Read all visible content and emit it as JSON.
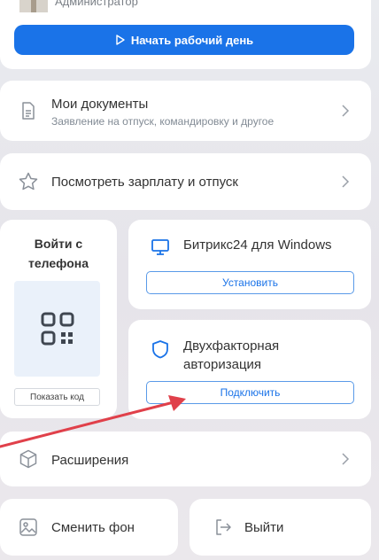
{
  "profile": {
    "role": "Администратор",
    "start_button": "Начать рабочий день",
    "start_icon": "play-icon"
  },
  "documents": {
    "title": "Мои документы",
    "subtitle": "Заявление на отпуск, командировку и другое",
    "icon": "document-icon"
  },
  "salary": {
    "title": "Посмотреть зарплату и отпуск",
    "icon": "star-icon"
  },
  "phone_login": {
    "title_line1": "Войти с",
    "title_line2": "телефона",
    "show_code": "Показать код",
    "icon": "qr-code-icon"
  },
  "windows_app": {
    "title": "Битрикс24 для Windows",
    "button": "Установить",
    "icon": "monitor-icon"
  },
  "two_factor": {
    "title_line1": "Двухфакторная",
    "title_line2": "авторизация",
    "button": "Подключить",
    "icon": "shield-icon"
  },
  "extensions": {
    "title": "Расширения",
    "icon": "cube-icon"
  },
  "change_background": {
    "title": "Сменить фон",
    "icon": "image-icon"
  },
  "logout": {
    "title": "Выйти",
    "icon": "logout-icon"
  },
  "colors": {
    "accent": "#1a73e8",
    "annotation_arrow": "#e0404a"
  }
}
